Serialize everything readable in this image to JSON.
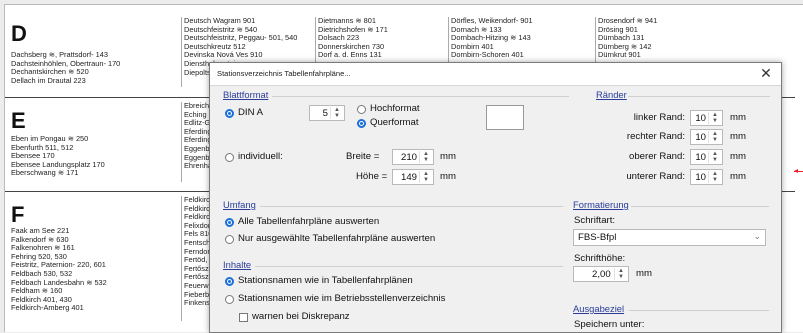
{
  "sections": [
    {
      "letter": "D",
      "names": [
        "Dachsberg ≋, Prattsdorf- 143",
        "Dachsteinhöhlen, Obertraun- 170",
        "Dechantskirchen ≋ 520",
        "Dellach im Drautal 223"
      ],
      "cols": [
        [
          "Deutsch Wagram 901",
          "Deutschfeistritz ≋ 540",
          "Deutschfeistritz, Peggau- 501, 540",
          "Deutschkreutz 512",
          "Devinska Nová Ves 910",
          "Diensthuberstein",
          "Diepoltsdorf ≋"
        ],
        [
          "Dietmanns ≋ 801",
          "Dietrichshofen ≋ 171",
          "Dolsach 223",
          "Donnerskirchen 730",
          "Dorf a. d. Enns 131"
        ],
        [
          "Dörfles, Weikendorf- 901",
          "Dornach ≋ 133",
          "Dornbach-Hitzing ≋ 143",
          "Dornbirn 401",
          "Dornbirn-Schoren 401"
        ],
        [
          "Drosendorf ≋ 941",
          "Drösing 901",
          "Dürnbach 131",
          "Dürnberg ≋ 142",
          "Dürnkrut 901"
        ]
      ]
    },
    {
      "letter": "E",
      "names": [
        "Eben im Pongau ≋ 250",
        "Ebenfurth 511, 512",
        "Ebensee 170",
        "Ebensee Landungsplatz 170",
        "Eberschwang ≋ 171"
      ],
      "cols": [
        [
          "Ebreichsdorf 5",
          "Eching ≋ 210",
          "Edlitz-Grimme",
          "Eferding Gewe",
          "Eferding ≋ 14",
          "Eggenberg, V",
          "Eggenburg 80",
          "Ehrenhausen"
        ]
      ]
    },
    {
      "letter": "F",
      "names": [
        "Faak am See 221",
        "Falkendorf ≋ 630",
        "Falkenohren ≋ 161",
        "Fehring 520, 530",
        "Feistritz, Paternion- 220, 601",
        "Feldbach 530, 532",
        "Feldbach Landesbahn ≋ 532",
        "Feldham ≋ 160",
        "Feldkirch 401, 430",
        "Feldkirch-Amberg 401"
      ],
      "cols": [
        [
          "Feldkirchen in",
          "Feldkirchen, F",
          "Feldkirchen-Se",
          "Felixdorf 510,",
          "Fels 810",
          "Fentsch-St. Lo",
          "Ferndorf 220,",
          "Fertöd, Fertősz",
          "Fertőszentmikl",
          "Fertőszéplak-F",
          "Feuerwerksan",
          "Fieberbrunn 2",
          "Finkenstein 22"
        ]
      ]
    }
  ],
  "dialog": {
    "title": "Stationsverzeichnis Tabellenfahrpläne...",
    "blattformat": {
      "label": "Blattformat",
      "din_label": "DIN A",
      "din_value": "5",
      "hochformat": "Hochformat",
      "querformat": "Querformat",
      "individuell": "individuell:",
      "breite_label": "Breite =",
      "breite_value": "210",
      "hoehe_label": "Höhe =",
      "hoehe_value": "149",
      "unit": "mm"
    },
    "raender": {
      "label": "Ränder",
      "rows": [
        {
          "label": "linker Rand:",
          "value": "10",
          "unit": "mm"
        },
        {
          "label": "rechter Rand:",
          "value": "10",
          "unit": "mm"
        },
        {
          "label": "oberer Rand:",
          "value": "10",
          "unit": "mm"
        },
        {
          "label": "unterer Rand:",
          "value": "10",
          "unit": "mm"
        }
      ]
    },
    "umfang": {
      "label": "Umfang",
      "opt1": "Alle Tabellenfahrpläne auswerten",
      "opt2": "Nur ausgewählte Tabellenfahrpläne auswerten"
    },
    "inhalte": {
      "label": "Inhalte",
      "opt1": "Stationsnamen wie in Tabellenfahrplänen",
      "opt2": "Stationsnamen wie im Betriebsstellenverzeichnis",
      "chk": "warnen bei Diskrepanz"
    },
    "formatierung": {
      "label": "Formatierung",
      "schriftart_label": "Schriftart:",
      "schriftart_value": "FBS-Bfpl",
      "schrifthoehe_label": "Schrifthöhe:",
      "schrifthoehe_value": "2,00",
      "unit": "mm"
    },
    "ausgabeziel": {
      "label": "Ausgabeziel",
      "speichern": "Speichern unter:"
    }
  }
}
